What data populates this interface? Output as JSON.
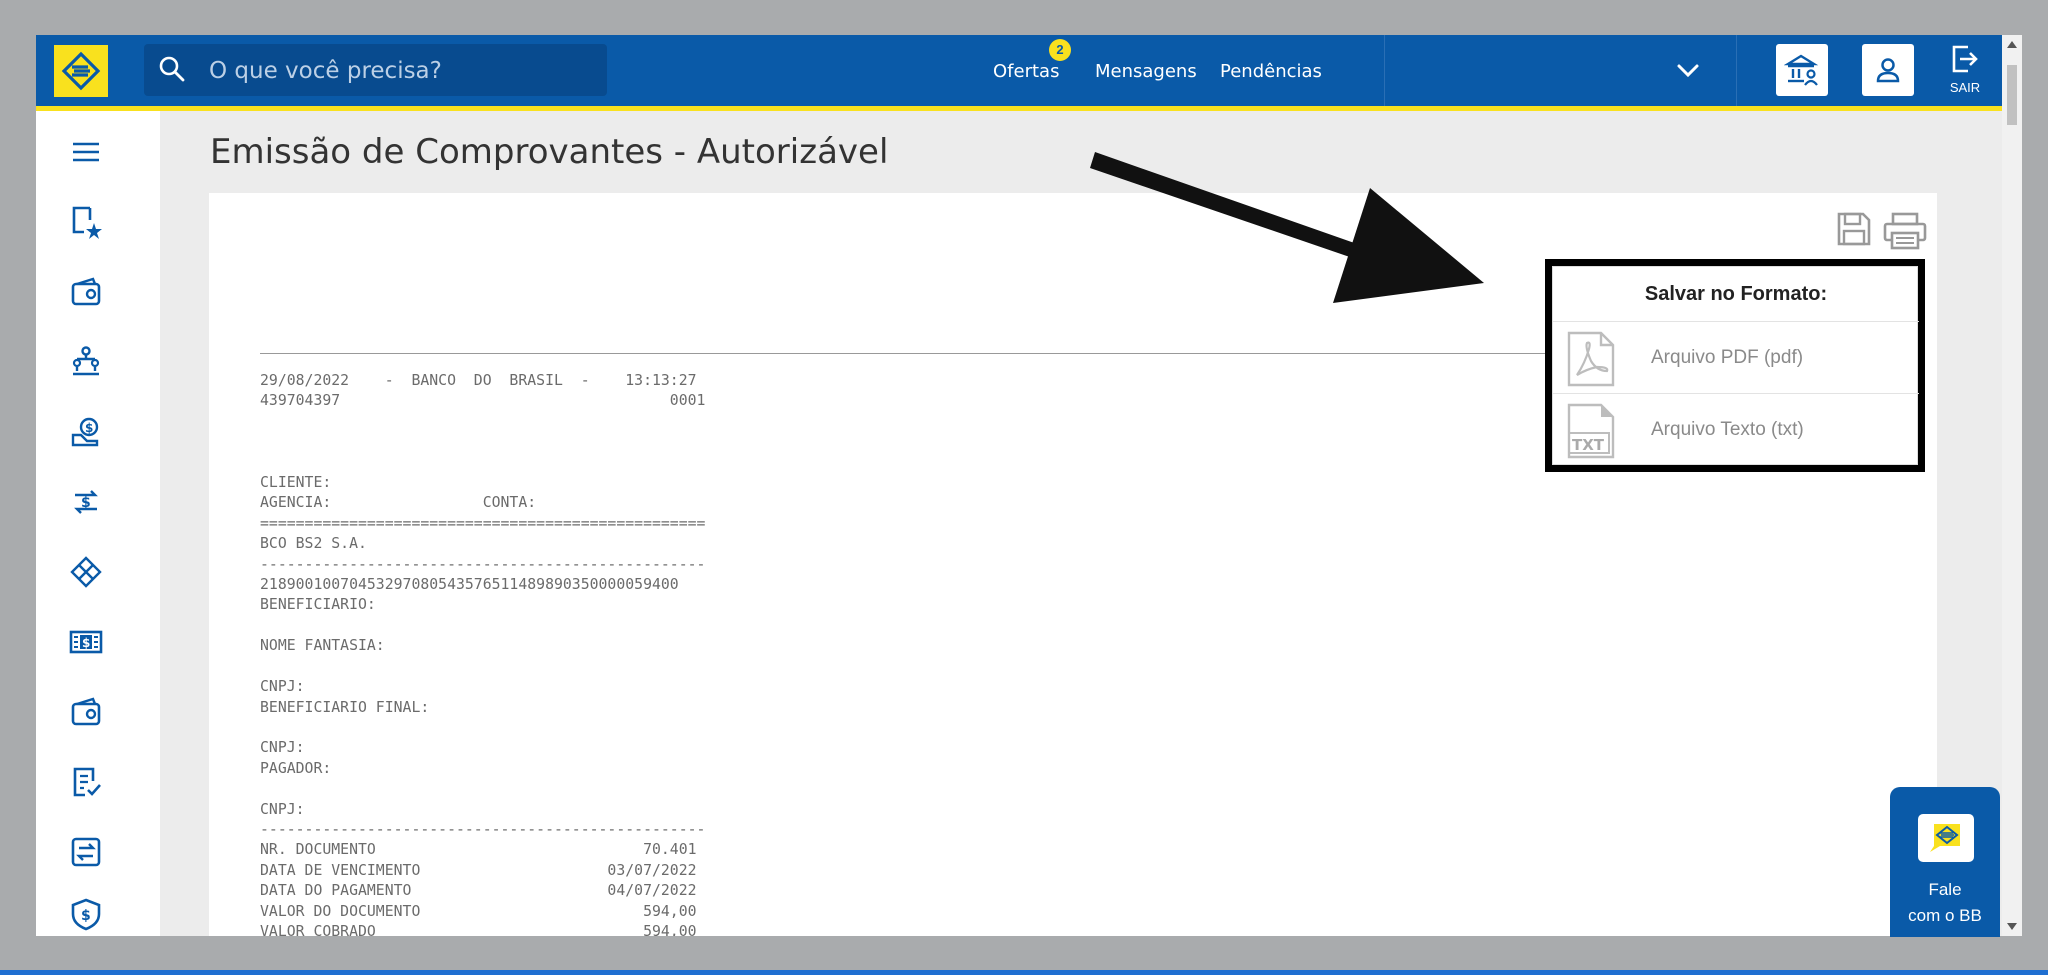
{
  "header": {
    "search_placeholder": "O que você precisa?",
    "nav": [
      {
        "label": "Ofertas",
        "badge": "2"
      },
      {
        "label": "Mensagens"
      },
      {
        "label": "Pendências"
      }
    ],
    "logout_label": "SAIR"
  },
  "page": {
    "title": "Emissão de Comprovantes - Autorizável"
  },
  "receipt_text": "29/08/2022    -  BANCO  DO  BRASIL  -    13:13:27\n439704397                                     0001\n\n\n\nCLIENTE:\nAGENCIA:                 CONTA:\n==================================================\nBCO BS2 S.A.\n--------------------------------------------------\n21890010070453297080543576511489890350000059400\nBENEFICIARIO:\n\nNOME FANTASIA:\n\nCNPJ:\nBENEFICIARIO FINAL:\n\nCNPJ:\nPAGADOR:\n\nCNPJ:\n--------------------------------------------------\nNR. DOCUMENTO                              70.401\nDATA DE VENCIMENTO                     03/07/2022\nDATA DO PAGAMENTO                      04/07/2022\nVALOR DO DOCUMENTO                         594,00\nVALOR COBRADO                              594,00",
  "save_menu": {
    "title": "Salvar no Formato:",
    "items": [
      {
        "label": "Arquivo PDF (pdf)",
        "icon": "pdf-file-icon"
      },
      {
        "label": "Arquivo Texto (txt)",
        "icon": "txt-file-icon",
        "icon_text": "TXT"
      }
    ]
  },
  "fale": {
    "line1": "Fale",
    "line2": "com o BB"
  },
  "colors": {
    "brand_blue": "#0a5aa8",
    "brand_yellow": "#f9e11e"
  }
}
